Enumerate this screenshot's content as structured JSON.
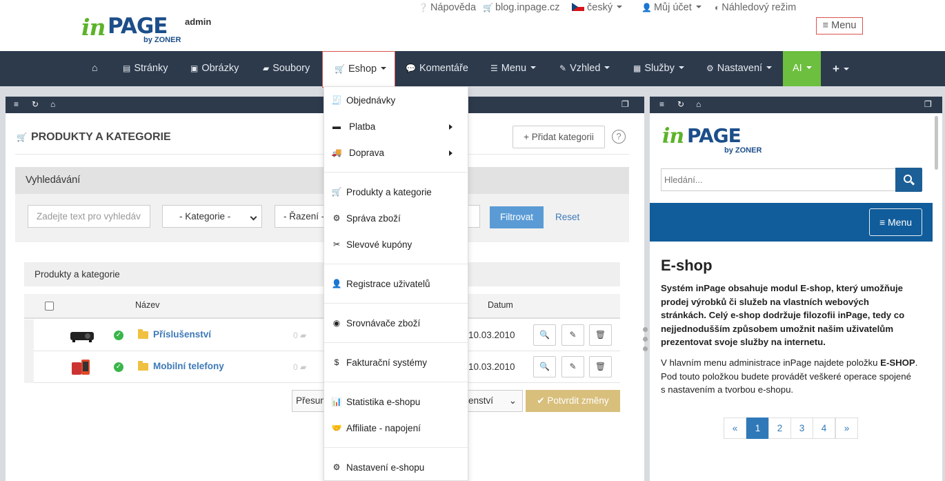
{
  "header": {
    "logo_in": "in",
    "logo_page": "PAGE",
    "logo_by": "by ZONER",
    "admin": "admin",
    "help": "Nápověda",
    "blog": "blog.inpage.cz",
    "language": "český",
    "account": "Můj účet",
    "preview": "Náhledový režim",
    "menu": "Menu"
  },
  "nav": {
    "items": [
      {
        "label": ""
      },
      {
        "label": "Stránky"
      },
      {
        "label": "Obrázky"
      },
      {
        "label": "Soubory"
      },
      {
        "label": "Eshop"
      },
      {
        "label": "Komentáře"
      },
      {
        "label": "Menu"
      },
      {
        "label": "Vzhled"
      },
      {
        "label": "Služby"
      },
      {
        "label": "Nastavení"
      },
      {
        "label": "AI"
      },
      {
        "label": ""
      }
    ]
  },
  "eshop_menu": {
    "items": [
      {
        "label": "Objednávky",
        "icon": "invoice-icon"
      },
      {
        "label": "Platba",
        "icon": "credit-card-icon"
      },
      {
        "label": "Doprava",
        "icon": "truck-icon"
      },
      {
        "label": "Produkty a kategorie",
        "icon": "cart-icon"
      },
      {
        "label": "Správa zboží",
        "icon": "gear-icon"
      },
      {
        "label": "Slevové kupóny",
        "icon": "scissors-icon"
      },
      {
        "label": "Registrace uživatelů",
        "icon": "user-icon"
      },
      {
        "label": "Srovnávače zboží",
        "icon": "rss-icon"
      },
      {
        "label": "Fakturační systémy",
        "icon": "dollar-icon"
      },
      {
        "label": "Statistika e-shopu",
        "icon": "chart-icon"
      },
      {
        "label": "Affiliate - napojení",
        "icon": "handshake-icon"
      },
      {
        "label": "Nastavení e-shopu",
        "icon": "gear-icon"
      }
    ]
  },
  "main": {
    "title": "PRODUKTY A KATEGORIE",
    "add_category": "Přidat kategorii",
    "help": "?",
    "search": {
      "heading": "Vyhledávání",
      "placeholder": "Zadejte text pro vyhledáv",
      "category": "- Kategorie -",
      "sort": "- Řazení -",
      "filter": "Filtrovat",
      "reset": "Reset"
    },
    "list_heading": "Produkty a kategorie",
    "columns": {
      "name": "Název",
      "date": "Datum"
    },
    "rows": [
      {
        "name": "Příslušenství",
        "count": "0",
        "date": "10.03.2010"
      },
      {
        "name": "Mobilní telefony",
        "count": "0",
        "date": "10.03.2010"
      }
    ],
    "move_label": "Přesun",
    "move_select": "enství",
    "confirm": "Potvrdit změny"
  },
  "preview": {
    "logo_in": "in",
    "logo_page": "PAGE",
    "logo_by": "by ZONER",
    "search_placeholder": "Hledání...",
    "menu": "Menu",
    "heading": "E-shop",
    "para_bold_1": "Systém inPage obsahuje modul E-shop, který umožňuje",
    "para_bold_2": "prodej výrobků či služeb na vlastních webových",
    "para_bold_3": "stránkách. Celý e-shop dodržuje filozofii inPage, tedy co",
    "para_bold_4": "nejjednodušším způsobem umožnit našim uživatelům",
    "para_bold_5": "prezentovat svoje služby na internetu.",
    "para_2a": "V hlavním menu administrace inPage najdete položku ",
    "para_2a_bold": "E-SHOP",
    "para_2a_end": ".",
    "para_2b": "Pod touto položkou budete provádět veškeré operace spojené",
    "para_2c": "s nastavením a tvorbou e-shopu.",
    "pager": [
      "«",
      "1",
      "2",
      "3",
      "4",
      "»"
    ]
  },
  "colors": {
    "nav_bg": "#2c3a4c",
    "accent_blue": "#115c9a",
    "ai_green": "#6dbf3f",
    "active_border": "#d9534f"
  }
}
